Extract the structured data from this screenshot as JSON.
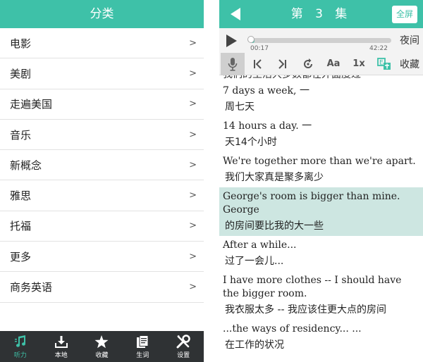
{
  "left": {
    "title": "分类",
    "categories": [
      {
        "label": "电影"
      },
      {
        "label": "美剧"
      },
      {
        "label": "走遍美国"
      },
      {
        "label": "音乐"
      },
      {
        "label": "新概念"
      },
      {
        "label": "雅思"
      },
      {
        "label": "托福"
      },
      {
        "label": "更多"
      },
      {
        "label": "商务英语"
      }
    ],
    "chevron": ">",
    "tabs": [
      {
        "label": "听力",
        "icon": "music-note-icon",
        "active": true
      },
      {
        "label": "本地",
        "icon": "download-icon"
      },
      {
        "label": "收藏",
        "icon": "star-icon"
      },
      {
        "label": "生词",
        "icon": "document-icon"
      },
      {
        "label": "设置",
        "icon": "tools-icon"
      }
    ],
    "accent": "#3ec1a8",
    "tabbar_color": "#2f3234"
  },
  "right": {
    "episode_title": "第 3 集",
    "fullscreen_label": "全屏",
    "player": {
      "elapsed": "00:17",
      "duration": "42:22",
      "progress_fraction": 0.007,
      "night_label": "夜间"
    },
    "toolbar": {
      "font_label": "Aa",
      "speed_label": "1x",
      "favorite_label": "收藏"
    },
    "clipped_line": "我们的生活大多数都在外面度过",
    "subtitles": [
      {
        "en": "7 days a week, 一",
        "zh": "周七天"
      },
      {
        "en": "14 hours a day. 一",
        "zh": "天14个小时"
      },
      {
        "en": "We're together more than we're apart.",
        "zh": "我们大家真是聚多离少"
      },
      {
        "en": "George's room is bigger than mine. George",
        "zh": "的房间要比我的大一些",
        "highlight": true
      },
      {
        "en": "After a while...",
        "zh": "过了一会儿..."
      },
      {
        "en": "I have more clothes -- I should have the bigger room.",
        "zh": "我衣服太多 -- 我应该住更大点的房间"
      },
      {
        "en": "...the ways of residency... ...",
        "zh": "在工作的状况"
      }
    ]
  }
}
